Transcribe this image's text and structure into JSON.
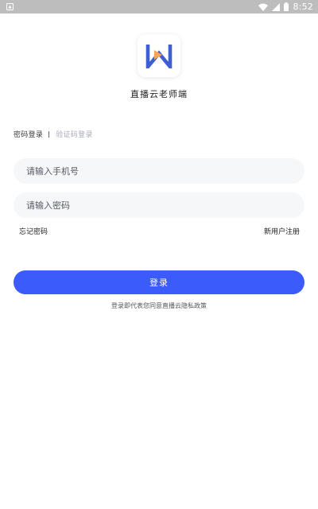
{
  "status_bar": {
    "time": "8:52",
    "icons": [
      "notification-icon",
      "wifi-icon",
      "signal-icon",
      "battery-icon"
    ]
  },
  "app": {
    "name": "直播云老师端",
    "logo_icon": "w-logo-icon"
  },
  "login_tabs": [
    {
      "label": "密码登录",
      "active": true
    },
    {
      "label": "验证码登录",
      "active": false
    }
  ],
  "form": {
    "phone": {
      "value": "",
      "placeholder": "请输入手机号"
    },
    "password": {
      "value": "",
      "placeholder": "请输入密码"
    }
  },
  "links": {
    "forgot_password": "忘记密码",
    "register": "新用户注册"
  },
  "login_button_label": "登录",
  "agreement_text": "登录即代表您同意直播云隐私政策",
  "colors": {
    "primary": "#3b5bfa",
    "logo_blue": "#3d5fd1",
    "logo_orange": "#f5a35c",
    "field_bg": "#f6f7f9",
    "status_bar": "#bdbdbd"
  }
}
